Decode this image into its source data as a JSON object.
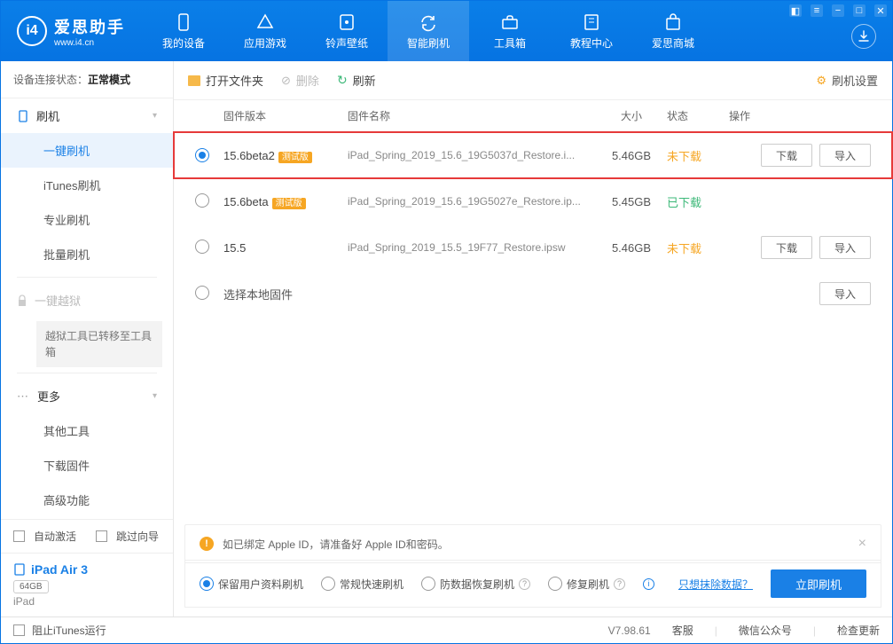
{
  "app": {
    "name": "爱思助手",
    "url": "www.i4.cn"
  },
  "nav": {
    "items": [
      {
        "label": "我的设备",
        "icon": "phone"
      },
      {
        "label": "应用游戏",
        "icon": "apps"
      },
      {
        "label": "铃声壁纸",
        "icon": "music"
      },
      {
        "label": "智能刷机",
        "icon": "refresh",
        "active": true
      },
      {
        "label": "工具箱",
        "icon": "toolbox"
      },
      {
        "label": "教程中心",
        "icon": "book"
      },
      {
        "label": "爱思商城",
        "icon": "cart"
      }
    ]
  },
  "sidebar": {
    "status_label": "设备连接状态：",
    "status_value": "正常模式",
    "sections": {
      "flash": {
        "title": "刷机",
        "items": [
          "一键刷机",
          "iTunes刷机",
          "专业刷机",
          "批量刷机"
        ]
      },
      "jailbreak": {
        "title": "一键越狱",
        "note": "越狱工具已转移至工具箱"
      },
      "more": {
        "title": "更多",
        "items": [
          "其他工具",
          "下载固件",
          "高级功能"
        ]
      }
    },
    "auto_activate": "自动激活",
    "skip_guide": "跳过向导",
    "device": {
      "name": "iPad Air 3",
      "storage": "64GB",
      "type": "iPad"
    }
  },
  "toolbar": {
    "open": "打开文件夹",
    "delete": "删除",
    "refresh": "刷新",
    "settings": "刷机设置"
  },
  "table": {
    "headers": {
      "version": "固件版本",
      "name": "固件名称",
      "size": "大小",
      "status": "状态",
      "action": "操作"
    },
    "rows": [
      {
        "version": "15.6beta2",
        "beta": "测试版",
        "name": "iPad_Spring_2019_15.6_19G5037d_Restore.i...",
        "size": "5.46GB",
        "status": "未下载",
        "status_cls": "st-not",
        "selected": true,
        "highlight": true,
        "download": "下载",
        "import": "导入"
      },
      {
        "version": "15.6beta",
        "beta": "测试版",
        "name": "iPad_Spring_2019_15.6_19G5027e_Restore.ip...",
        "size": "5.45GB",
        "status": "已下载",
        "status_cls": "st-done"
      },
      {
        "version": "15.5",
        "name": "iPad_Spring_2019_15.5_19F77_Restore.ipsw",
        "size": "5.46GB",
        "status": "未下载",
        "status_cls": "st-not",
        "download": "下载",
        "import": "导入"
      },
      {
        "local": "选择本地固件",
        "import": "导入"
      }
    ]
  },
  "notice": "如已绑定 Apple ID，请准备好 Apple ID和密码。",
  "options": {
    "items": [
      "保留用户资料刷机",
      "常规快速刷机",
      "防数据恢复刷机",
      "修复刷机"
    ],
    "erase_link": "只想抹除数据？",
    "flash_btn": "立即刷机"
  },
  "statusbar": {
    "block_itunes": "阻止iTunes运行",
    "version": "V7.98.61",
    "links": [
      "客服",
      "微信公众号",
      "检查更新"
    ]
  }
}
